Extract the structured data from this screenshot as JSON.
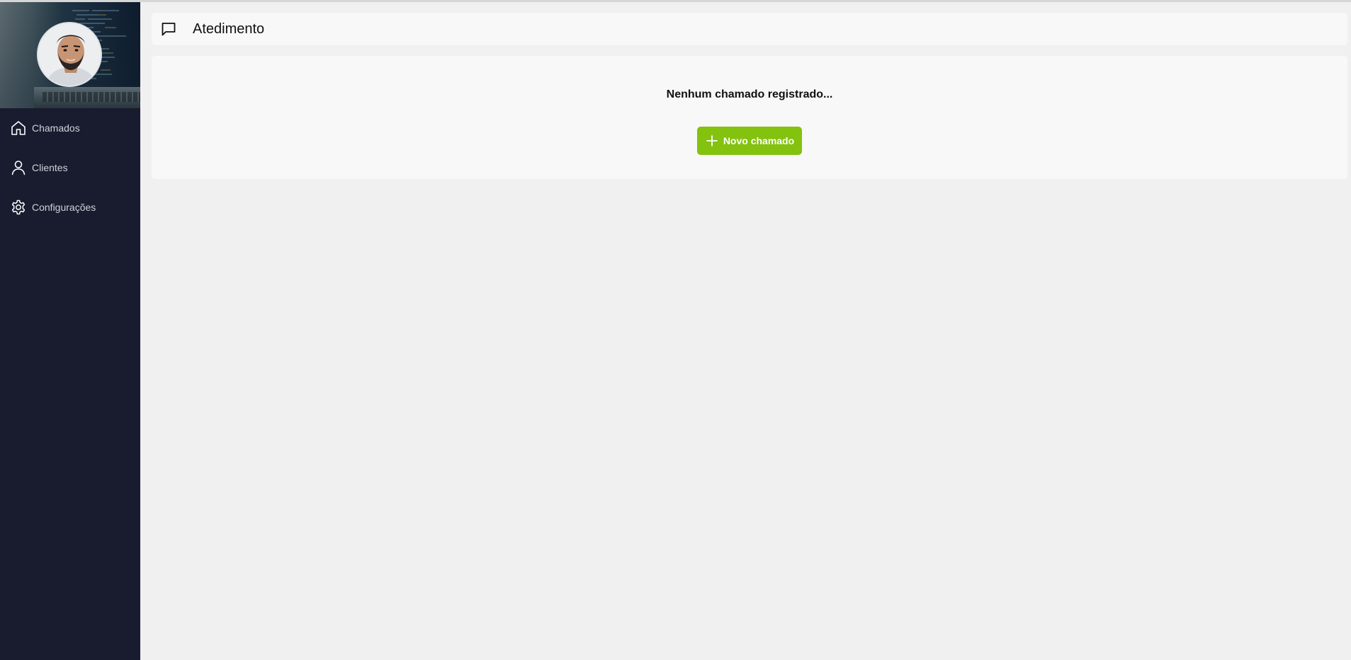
{
  "sidebar": {
    "avatar_alt_icon": "user-photo",
    "items": [
      {
        "label": "Chamados",
        "icon": "home-icon"
      },
      {
        "label": "Clientes",
        "icon": "user-icon"
      },
      {
        "label": "Configurações",
        "icon": "settings-icon"
      }
    ]
  },
  "header": {
    "icon": "message-square-icon",
    "title": "Atedimento"
  },
  "main": {
    "empty_message": "Nenhum chamado registrado...",
    "new_button_label": "Novo chamado"
  },
  "colors": {
    "sidebar_bg": "#181c2e",
    "accent_green": "#83c20e",
    "page_bg": "#f0f0f0",
    "card_bg": "#f8f8f8"
  }
}
